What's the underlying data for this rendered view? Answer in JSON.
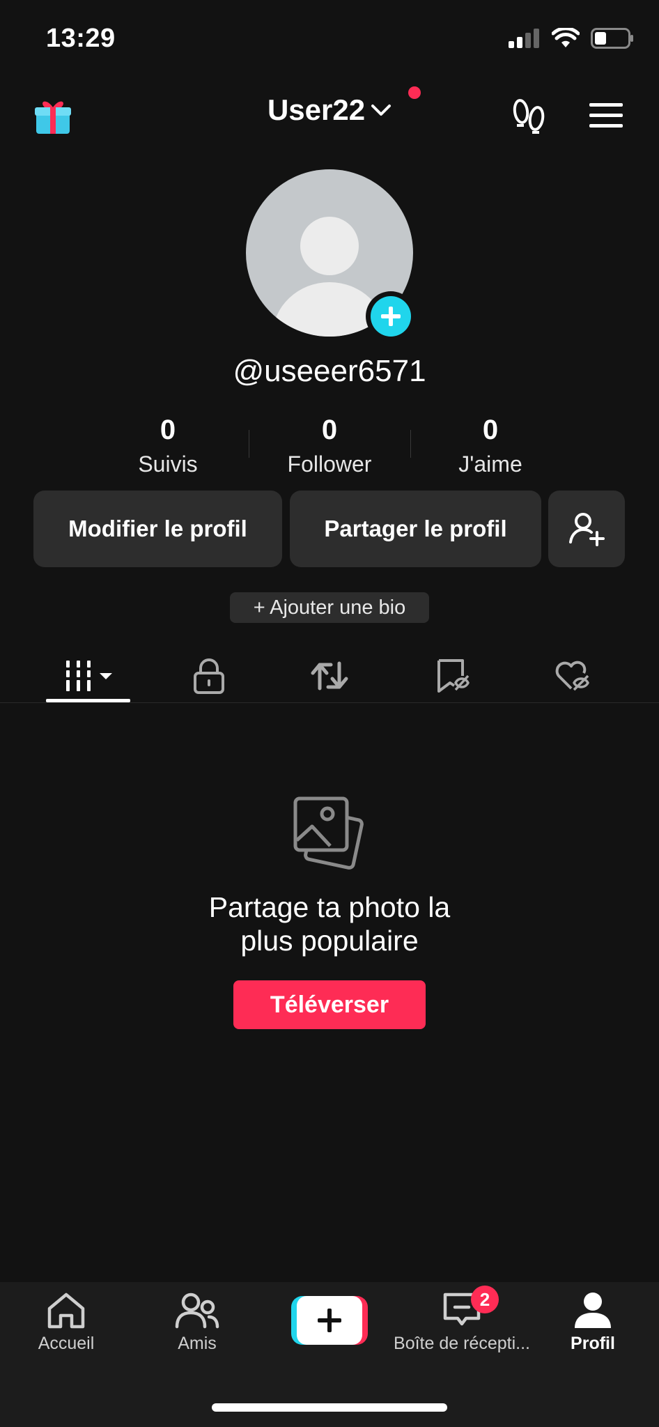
{
  "status_bar": {
    "time": "13:29",
    "battery_level": 0.35
  },
  "header": {
    "username": "User22"
  },
  "profile": {
    "handle": "@useeer6571",
    "stats": [
      {
        "value": "0",
        "label": "Suivis"
      },
      {
        "value": "0",
        "label": "Follower"
      },
      {
        "value": "0",
        "label": "J'aime"
      }
    ]
  },
  "actions": {
    "edit_label": "Modifier le profil",
    "share_label": "Partager le profil"
  },
  "bio": {
    "add_label": "+ Ajouter une bio"
  },
  "tabs": [
    {
      "icon": "grid-icon",
      "active": true
    },
    {
      "icon": "lock-icon",
      "active": false
    },
    {
      "icon": "repost-icon",
      "active": false
    },
    {
      "icon": "hidden-bookmark-icon",
      "active": false
    },
    {
      "icon": "hidden-heart-icon",
      "active": false
    }
  ],
  "empty_state": {
    "title_line1": "Partage ta photo la",
    "title_line2": "plus populaire",
    "button_label": "Téléverser"
  },
  "nav": {
    "items": [
      {
        "label": "Accueil",
        "icon": "home-icon"
      },
      {
        "label": "Amis",
        "icon": "friends-icon"
      },
      {
        "label": "",
        "icon": "plus-icon"
      },
      {
        "label": "Boîte de récepti...",
        "icon": "inbox-icon",
        "badge": "2"
      },
      {
        "label": "Profil",
        "icon": "profile-icon",
        "active": true
      }
    ]
  },
  "colors": {
    "background": "#121212",
    "accent_red": "#fe2c55",
    "accent_cyan": "#20d5ec",
    "surface": "#2d2d2d"
  }
}
